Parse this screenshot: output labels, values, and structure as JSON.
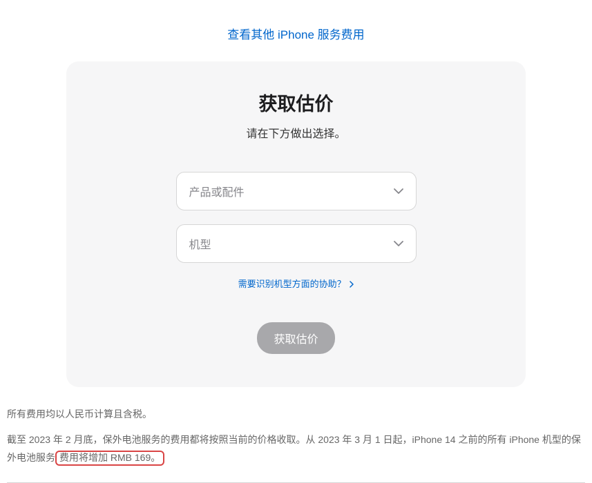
{
  "topLink": {
    "label": "查看其他 iPhone 服务费用"
  },
  "card": {
    "title": "获取估价",
    "subtitle": "请在下方做出选择。",
    "selects": {
      "product": {
        "placeholder": "产品或配件"
      },
      "model": {
        "placeholder": "机型"
      }
    },
    "helpLink": {
      "label": "需要识别机型方面的协助？"
    },
    "submitButton": {
      "label": "获取估价"
    }
  },
  "footer": {
    "line1": "所有费用均以人民币计算且含税。",
    "line2_part1": "截至 2023 年 2 月底，保外电池服务的费用都将按照当前的价格收取。从 2023 年 3 月 1 日起，iPhone 14 之前的所有 iPhone 机型的保外电池服务",
    "line2_highlight": "费用将增加 RMB 169。"
  }
}
